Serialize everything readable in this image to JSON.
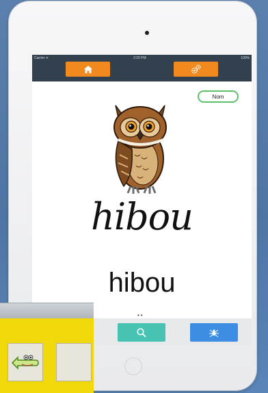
{
  "status_bar": {
    "carrier": "Carrier ᯤ",
    "time": "2:20 PM",
    "battery": "100%"
  },
  "toolbar": {
    "home_icon": "home-icon",
    "settings_icon": "gears-icon"
  },
  "card": {
    "name_button_label": "Nom",
    "image_name": "owl-illustration",
    "cursive_word": "hibou",
    "print_word": "hibou",
    "page_dots": "••"
  },
  "bottom_bar": {
    "search_icon": "search-icon",
    "spider_icon": "spider-icon"
  },
  "overlay": {
    "tile_icon": "crocodile-back-icon"
  },
  "colors": {
    "orange": "#f08a1f",
    "teal": "#46c3b2",
    "blue": "#3d8ee2",
    "name_border": "#5cc16b",
    "overlay_yellow": "#f1d80b",
    "topbar": "#33414e"
  }
}
